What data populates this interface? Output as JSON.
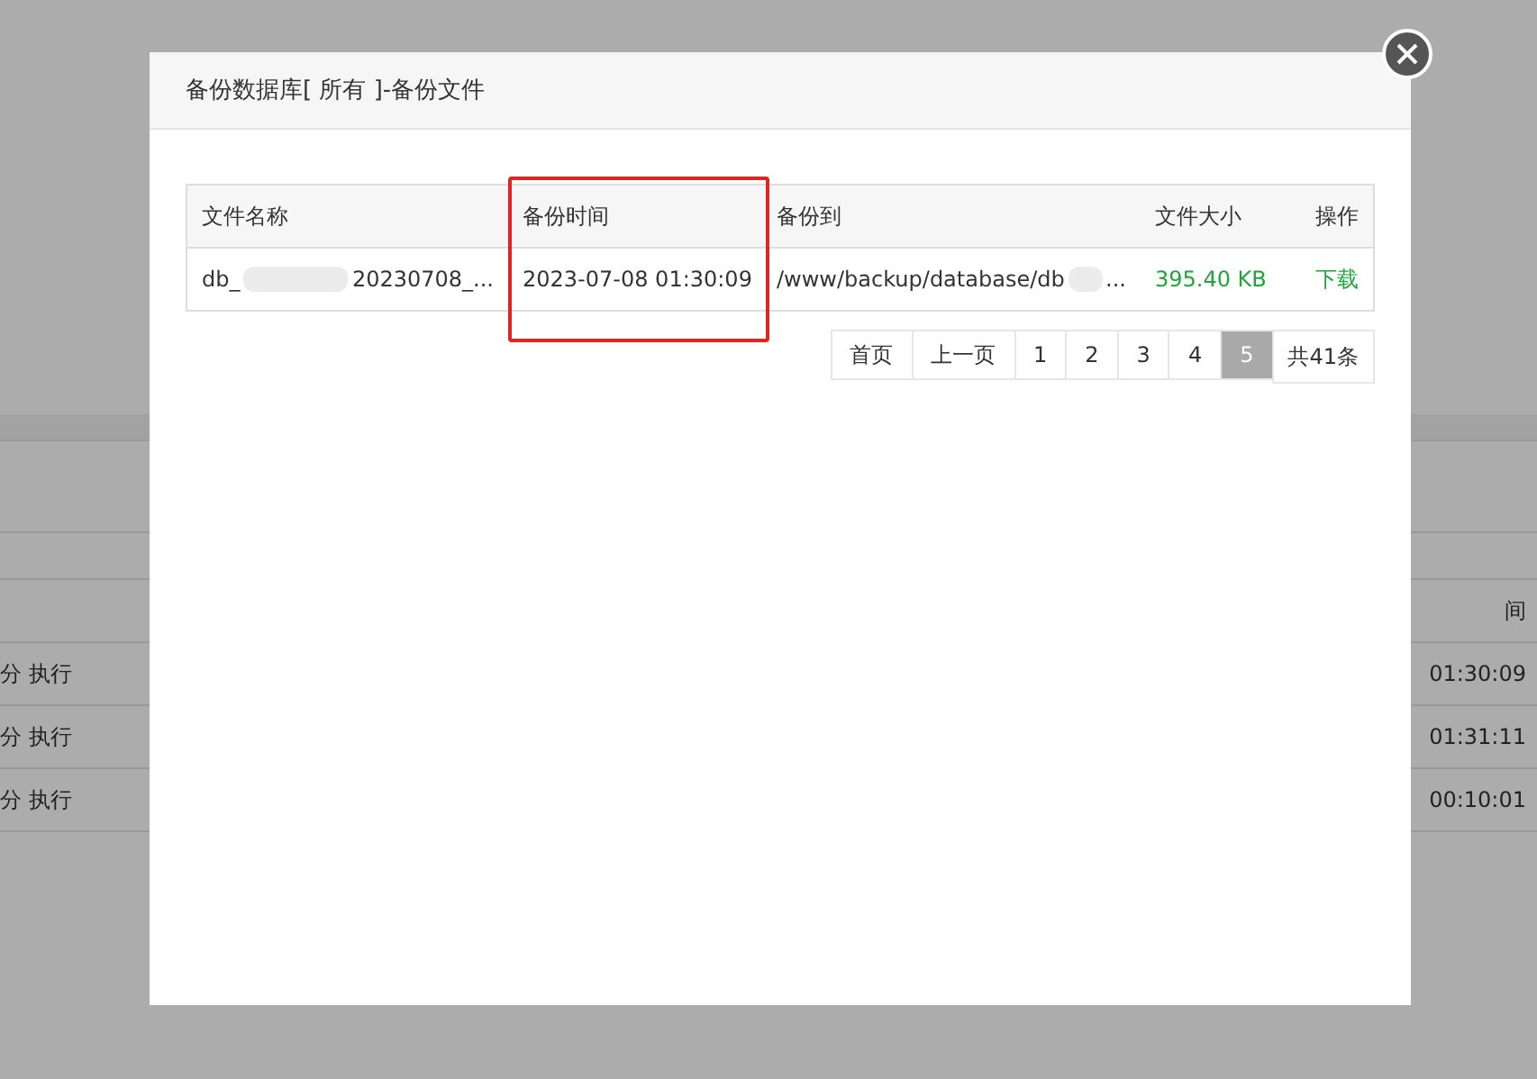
{
  "background_page": {
    "table_header_right": "间",
    "rows": [
      {
        "left": "分 执行",
        "right": "01:30:09"
      },
      {
        "left": "分 执行",
        "right": "01:31:11"
      },
      {
        "left": "分 执行",
        "right": "00:10:01"
      }
    ]
  },
  "dialog": {
    "title": "备份数据库[ 所有 ]-备份文件",
    "table": {
      "columns": [
        {
          "label": "文件名称",
          "highlighted": false
        },
        {
          "label": "备份时间",
          "highlighted": true
        },
        {
          "label": "备份到",
          "highlighted": false
        },
        {
          "label": "文件大小",
          "highlighted": false
        },
        {
          "label": "操作",
          "highlighted": false
        }
      ],
      "rows": [
        {
          "file_name_start": "db_",
          "file_name_end": "20230708_...",
          "time": "2023-07-08 01:30:09",
          "path_start": "/www/backup/database/db",
          "path_end": "...",
          "size": "395.40 KB",
          "action": "下载"
        }
      ]
    },
    "pagination": [
      {
        "label": "首页",
        "selected": false
      },
      {
        "label": "上一页",
        "selected": false
      },
      {
        "label": "1",
        "selected": false
      },
      {
        "label": "2",
        "selected": false
      },
      {
        "label": "3",
        "selected": false
      },
      {
        "label": "4",
        "selected": false
      },
      {
        "label": "5",
        "selected": true
      }
    ],
    "total": "共41条"
  }
}
